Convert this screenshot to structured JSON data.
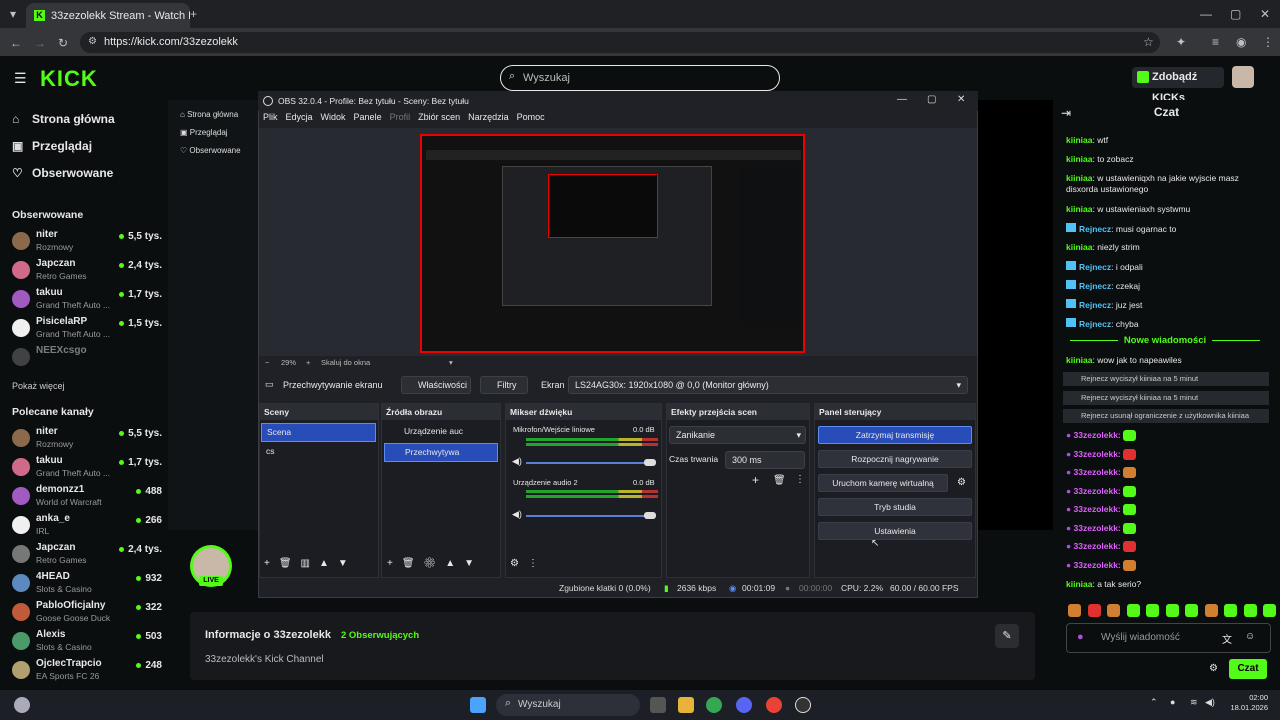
{
  "browser": {
    "tab_title": "33zezolekk Stream - Watch Live",
    "url": "https://kick.com/33zezolekk"
  },
  "kick": {
    "search_placeholder": "Wyszukaj",
    "get_kicks": "Zdobądź KICKs",
    "nav": [
      "Strona główna",
      "Przeglądaj",
      "Obserwowane"
    ],
    "followed_header": "Obserwowane",
    "followed": [
      {
        "name": "niter",
        "game": "Rozmowy",
        "viewers": "5,5 tys."
      },
      {
        "name": "Japczan",
        "game": "Retro Games",
        "viewers": "2,4 tys."
      },
      {
        "name": "takuu",
        "game": "Grand Theft Auto ...",
        "viewers": "1,7 tys."
      },
      {
        "name": "PisicelaRP",
        "game": "Grand Theft Auto ...",
        "viewers": "1,5 tys."
      },
      {
        "name": "NEEXcsgo",
        "game": "",
        "viewers": ""
      }
    ],
    "show_more": "Pokaż więcej",
    "recommended_header": "Polecane kanały",
    "recommended": [
      {
        "name": "niter",
        "game": "Rozmowy",
        "viewers": "5,5 tys."
      },
      {
        "name": "takuu",
        "game": "Grand Theft Auto ...",
        "viewers": "1,7 tys."
      },
      {
        "name": "demonzz1",
        "game": "World of Warcraft",
        "viewers": "488"
      },
      {
        "name": "anka_e",
        "game": "IRL",
        "viewers": "266"
      },
      {
        "name": "Japczan",
        "game": "Retro Games",
        "viewers": "2,4 tys."
      },
      {
        "name": "4HEAD",
        "game": "Slots & Casino",
        "viewers": "932"
      },
      {
        "name": "PabloOficjalny",
        "game": "Goose Goose Duck",
        "viewers": "322"
      },
      {
        "name": "Alexis",
        "game": "Slots & Casino",
        "viewers": "503"
      },
      {
        "name": "OjcIecTrapcio",
        "game": "EA Sports FC 26",
        "viewers": "248"
      }
    ],
    "live_badge": "LIVE",
    "info_title": "Informacje o 33zezolekk",
    "info_followers": "2 Obserwujących",
    "info_desc": "33zezolekk's Kick Channel"
  },
  "chat": {
    "title": "Czat",
    "messages": [
      {
        "user": "kiiniaa",
        "text": "wtf"
      },
      {
        "user": "kiiniaa",
        "text": "to zobacz"
      },
      {
        "user": "kiiniaa",
        "text": "w ustawieniqxh na jakie wyjscie masz disxorda ustawionego"
      },
      {
        "user": "kiiniaa",
        "text": "w ustawieniaxh systwmu"
      },
      {
        "user": "Rejnecz",
        "text": "musi ogarnac to"
      },
      {
        "user": "kiiniaa",
        "text": "niezly strim"
      },
      {
        "user": "Rejnecz",
        "text": "i odpali"
      },
      {
        "user": "Rejnecz",
        "text": "czekaj"
      },
      {
        "user": "Rejnecz",
        "text": "juz jest"
      },
      {
        "user": "Rejnecz",
        "text": "chyba"
      }
    ],
    "new_messages": "Nowe wiadomości",
    "after": {
      "user": "kiiniaa",
      "text": "wow jak to napeawiles"
    },
    "system": [
      "Rejnecz wyciszył kiiniaa na 5 minut",
      "Rejnecz wyciszył kiiniaa na 5 minut",
      "Rejnecz usunął ograniczenie z użytkownika kiiniaa"
    ],
    "emote_user": "33zezolekk:",
    "last": {
      "user": "kiiniaa",
      "text": "a tak serio?"
    },
    "input_placeholder": "Wyślij wiadomość",
    "send": "Czat"
  },
  "obs": {
    "title": "OBS 32.0.4 - Profile: Bez tytułu - Sceny: Bez tytułu",
    "menu": [
      "Plik",
      "Edycja",
      "Widok",
      "Panele",
      "Profil",
      "Zbiór scen",
      "Narzędzia",
      "Pomoc"
    ],
    "zoom": "29%",
    "scale": "Skaluj do okna",
    "source_name": "Przechwytywanie ekranu",
    "properties": "Właściwości",
    "filters": "Filtry",
    "screen_label": "Ekran",
    "screen_value": "LS24AG30x: 1920x1080 @ 0,0 (Monitor główny)",
    "scenes_title": "Sceny",
    "scenes": [
      "Scena",
      "cs"
    ],
    "sources_title": "Źródła obrazu",
    "sources": [
      "Urządzenie auc",
      "Przechwytywa"
    ],
    "mixer_title": "Mikser dźwięku",
    "mixer": [
      {
        "name": "Mikrofon/Wejście liniowe",
        "db": "0.0 dB"
      },
      {
        "name": "Urządzenie audio 2",
        "db": "0.0 dB"
      }
    ],
    "transitions_title": "Efekty przejścia scen",
    "transition": "Zanikanie",
    "duration_label": "Czas trwania",
    "duration": "300 ms",
    "controls_title": "Panel sterujący",
    "controls": [
      "Zatrzymaj transmisję",
      "Rozpocznij nagrywanie",
      "Uruchom kamerę wirtualną",
      "Tryb studia",
      "Ustawienia"
    ],
    "status": {
      "dropped": "Zgubione klatki 0 (0.0%)",
      "bitrate": "2636 kbps",
      "stream_time": "00:01:09",
      "rec_time": "00:00:00",
      "cpu": "CPU: 2.2%",
      "fps": "60.00 / 60.00 FPS"
    }
  },
  "taskbar": {
    "search": "Wyszukaj",
    "time": "02:00",
    "date": "18.01.2026"
  }
}
